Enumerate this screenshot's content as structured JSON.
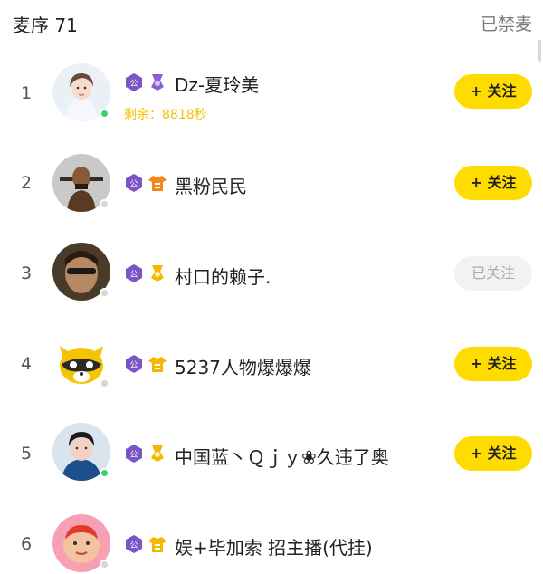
{
  "header": {
    "title": "麦序 71",
    "mute_label": "已禁麦"
  },
  "colors": {
    "accent_button": "#ffdc00",
    "online": "#3ccf6a",
    "offline": "#d6d6d6",
    "remaining_time": "#f2c200",
    "badge_purple": "#7b55c8",
    "badge_orange": "#f08a1a",
    "badge_yellow": "#f5b700"
  },
  "users": [
    {
      "rank": "1",
      "name": "Dz-夏玲美",
      "remaining": "剩余：8818秒",
      "status": "online",
      "button": "+ 关注",
      "followed": false,
      "badges": [
        "purple-shield-icon",
        "purple-ribbon-icon"
      ]
    },
    {
      "rank": "2",
      "name": "黑粉民民",
      "remaining": "",
      "status": "offline",
      "button": "+ 关注",
      "followed": false,
      "badges": [
        "purple-shield-icon",
        "orange-shirt-icon"
      ]
    },
    {
      "rank": "3",
      "name": "村口的赖子.",
      "remaining": "",
      "status": "offline",
      "button": "已关注",
      "followed": true,
      "badges": [
        "purple-shield-icon",
        "yellow-ribbon-icon"
      ]
    },
    {
      "rank": "4",
      "name": "5237人物爆爆爆",
      "remaining": "",
      "status": "offline",
      "button": "+ 关注",
      "followed": false,
      "badges": [
        "purple-shield-icon",
        "yellow-shirt-icon"
      ]
    },
    {
      "rank": "5",
      "name": "中国蓝丶Ｑｊｙ❀久违了奥",
      "remaining": "",
      "status": "online",
      "button": "+ 关注",
      "followed": false,
      "badges": [
        "purple-shield-icon",
        "yellow-ribbon-icon"
      ]
    },
    {
      "rank": "6",
      "name": "娱+毕加索 招主播(代挂)",
      "remaining": "",
      "status": "offline",
      "button": "",
      "followed": false,
      "badges": [
        "purple-shield-icon",
        "yellow-shirt-icon"
      ]
    }
  ]
}
